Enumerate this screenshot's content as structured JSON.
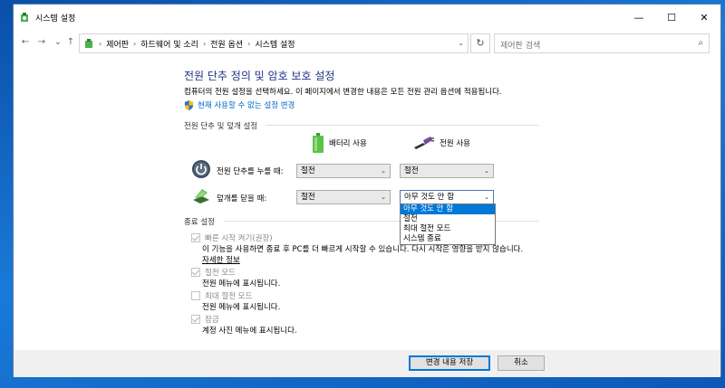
{
  "window": {
    "title": "시스템 설정",
    "minimize": "—",
    "maximize": "☐",
    "close": "✕"
  },
  "nav": {
    "back": "←",
    "forward": "→",
    "recent": "⌄",
    "up": "↑",
    "breadcrumb_sep": "›",
    "breadcrumbs": [
      "제어판",
      "하드웨어 및 소리",
      "전원 옵션",
      "시스템 설정"
    ],
    "dropdown": "⌄",
    "refresh": "↻",
    "search_placeholder": "제어판 검색",
    "search_icon": "⌕"
  },
  "main": {
    "heading": "전원 단추 정의 및 암호 보호 설정",
    "subtext": "컴퓨터의 전원 설정을 선택하세요. 이 페이지에서 변경한 내용은 모든 전원 관리 옵션에 적용됩니다.",
    "change_link": "현재 사용할 수 없는 설정 변경",
    "power_section_label": "전원 단추 및 덮개 설정",
    "col_battery": "배터리 사용",
    "col_plugged": "전원 사용",
    "rows": [
      {
        "label": "전원 단추를 누를 때:",
        "battery": "절전",
        "plugged": "절전"
      },
      {
        "label": "덮개를 닫을 때:",
        "battery": "절전",
        "plugged": "아무 것도 안 함"
      }
    ],
    "dropdown_options": [
      "아무 것도 안 함",
      "절전",
      "최대 절전 모드",
      "시스템 종료"
    ],
    "dropdown_selected_index": 0,
    "shutdown_section_label": "종료 설정",
    "shutdown_items": [
      {
        "label": "빠른 시작 켜기(권장)",
        "checked": true,
        "desc": "이 기능을 사용하면 종료 후 PC를 더 빠르게 시작할 수 있습니다. 다시 시작은 영향을 받지 않습니다.",
        "more": "자세한 정보"
      },
      {
        "label": "절전 모드",
        "checked": true,
        "desc": "전원 메뉴에 표시됩니다."
      },
      {
        "label": "최대 절전 모드",
        "checked": false,
        "desc": "전원 메뉴에 표시됩니다."
      },
      {
        "label": "잠금",
        "checked": true,
        "desc": "계정 사진 메뉴에 표시됩니다."
      }
    ]
  },
  "footer": {
    "save": "변경 내용 저장",
    "cancel": "취소"
  },
  "colors": {
    "heading": "#1e3287",
    "link": "#0066cc",
    "selection": "#0078d7"
  }
}
